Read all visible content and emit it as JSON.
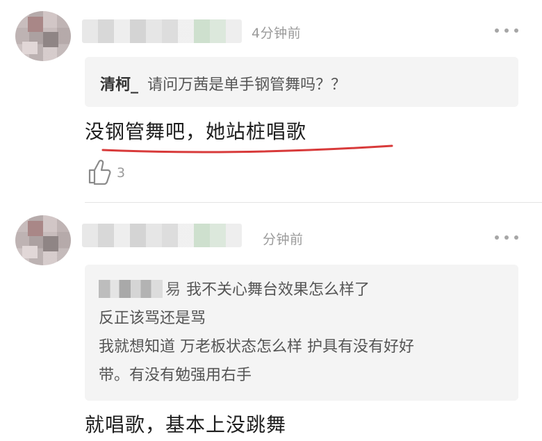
{
  "comments": [
    {
      "time": "4分钟前",
      "quote": {
        "author": "清柯_",
        "text": "请问万茜是单手钢管舞吗？？"
      },
      "reply": "没钢管舞吧，她站桩唱歌",
      "likes": "3"
    },
    {
      "time": "分钟前",
      "quote": {
        "author_tail": "易",
        "lines": [
          "我不关心舞台效果怎么样了",
          "反正该骂还是骂",
          "我就想知道 万老板状态怎么样 护具有没有好好",
          "带。有没有勉强用右手"
        ]
      },
      "reply": "就唱歌，基本上没跳舞"
    }
  ],
  "colors": {
    "highlight_underline": "#d83a3a",
    "muted_text": "#9a9a9a",
    "quote_background": "#f4f4f4"
  }
}
